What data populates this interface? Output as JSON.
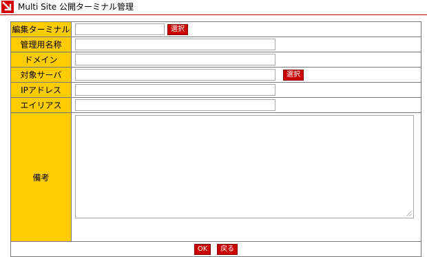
{
  "header": {
    "title": "Multi Site 公開ターミナル管理",
    "logo_icon": "red-arrow-logo"
  },
  "form": {
    "rows": [
      {
        "label": "編集ターミナル",
        "value": "",
        "button": "選択"
      },
      {
        "label": "管理用名称",
        "value": ""
      },
      {
        "label": "ドメイン",
        "value": ""
      },
      {
        "label": "対象サーバ",
        "value": "",
        "button": "選択"
      },
      {
        "label": "IPアドレス",
        "value": ""
      },
      {
        "label": "エイリアス",
        "value": ""
      }
    ],
    "memo": {
      "label": "備考",
      "value": ""
    }
  },
  "footer": {
    "ok_label": "OK",
    "back_label": "戻る"
  },
  "colors": {
    "label_bg": "#ffcc00",
    "button_bg": "#cc0000",
    "accent": "#c40000"
  }
}
